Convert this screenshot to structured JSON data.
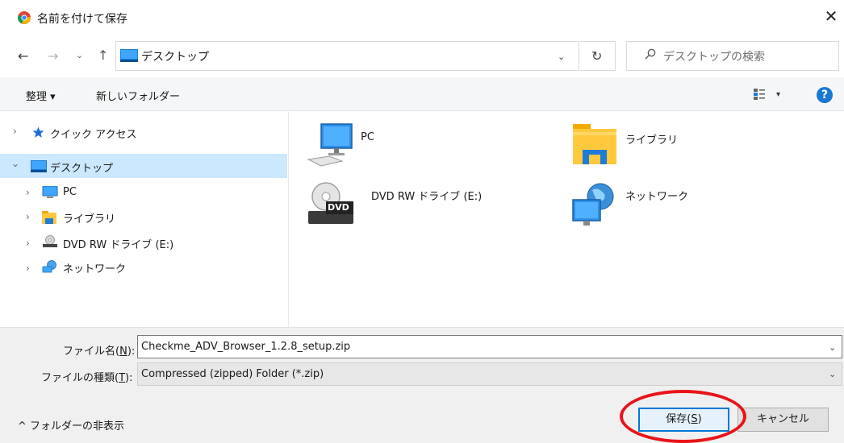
{
  "window": {
    "title": "名前を付けて保存",
    "close_glyph": "✕",
    "app_icon": "chrome-icon"
  },
  "nav": {
    "back_glyph": "←",
    "forward_glyph": "→",
    "recent_glyph": "⌄",
    "up_glyph": "↑",
    "address": "デスクトップ",
    "address_drop_glyph": "⌄",
    "refresh_glyph": "↻",
    "search_placeholder": "デスクトップの検索"
  },
  "toolbar": {
    "organize_label": "整理 ▾",
    "new_folder_label": "新しいフォルダー",
    "view_drop_glyph": "▾",
    "help_glyph": "?"
  },
  "tree": [
    {
      "label": "クイック アクセス",
      "icon": "star-icon",
      "expanded": false,
      "selected": false
    },
    {
      "label": "デスクトップ",
      "icon": "desktop-icon",
      "expanded": true,
      "selected": true
    },
    {
      "label": "PC",
      "icon": "pc-icon",
      "expanded": false,
      "selected": false
    },
    {
      "label": "ライブラリ",
      "icon": "library-icon",
      "expanded": false,
      "selected": false
    },
    {
      "label": "DVD RW ドライブ (E:)",
      "icon": "dvd-drive-icon",
      "expanded": false,
      "selected": false
    },
    {
      "label": "ネットワーク",
      "icon": "network-icon",
      "expanded": false,
      "selected": false
    }
  ],
  "tree_chevrons": {
    "collapsed": "›",
    "expanded": "⌄"
  },
  "items": [
    {
      "label": "PC",
      "icon": "pc-icon"
    },
    {
      "label": "ライブラリ",
      "icon": "library-icon"
    },
    {
      "label": "DVD RW ドライブ (E:)",
      "icon": "dvd-drive-icon",
      "badge": "DVD"
    },
    {
      "label": "ネットワーク",
      "icon": "network-icon"
    }
  ],
  "form": {
    "filename_label_prefix": "ファイル名(",
    "filename_label_key": "N",
    "filename_label_suffix": "):",
    "filename_value": "Checkme_ADV_Browser_1.2.8_setup.zip",
    "filetype_label_prefix": "ファイルの種類(",
    "filetype_label_key": "T",
    "filetype_label_suffix": "):",
    "filetype_value": "Compressed (zipped) Folder (*.zip)",
    "drop_glyph": "⌄"
  },
  "footer": {
    "hide_folders_label": "^ フォルダーの非表示",
    "save_label_prefix": "保存(",
    "save_label_key": "S",
    "save_label_suffix": ")",
    "cancel_label": "キャンセル"
  },
  "colors": {
    "accent": "#0078d7",
    "selection": "#cce8ff",
    "highlight_ring": "#e8141a"
  }
}
